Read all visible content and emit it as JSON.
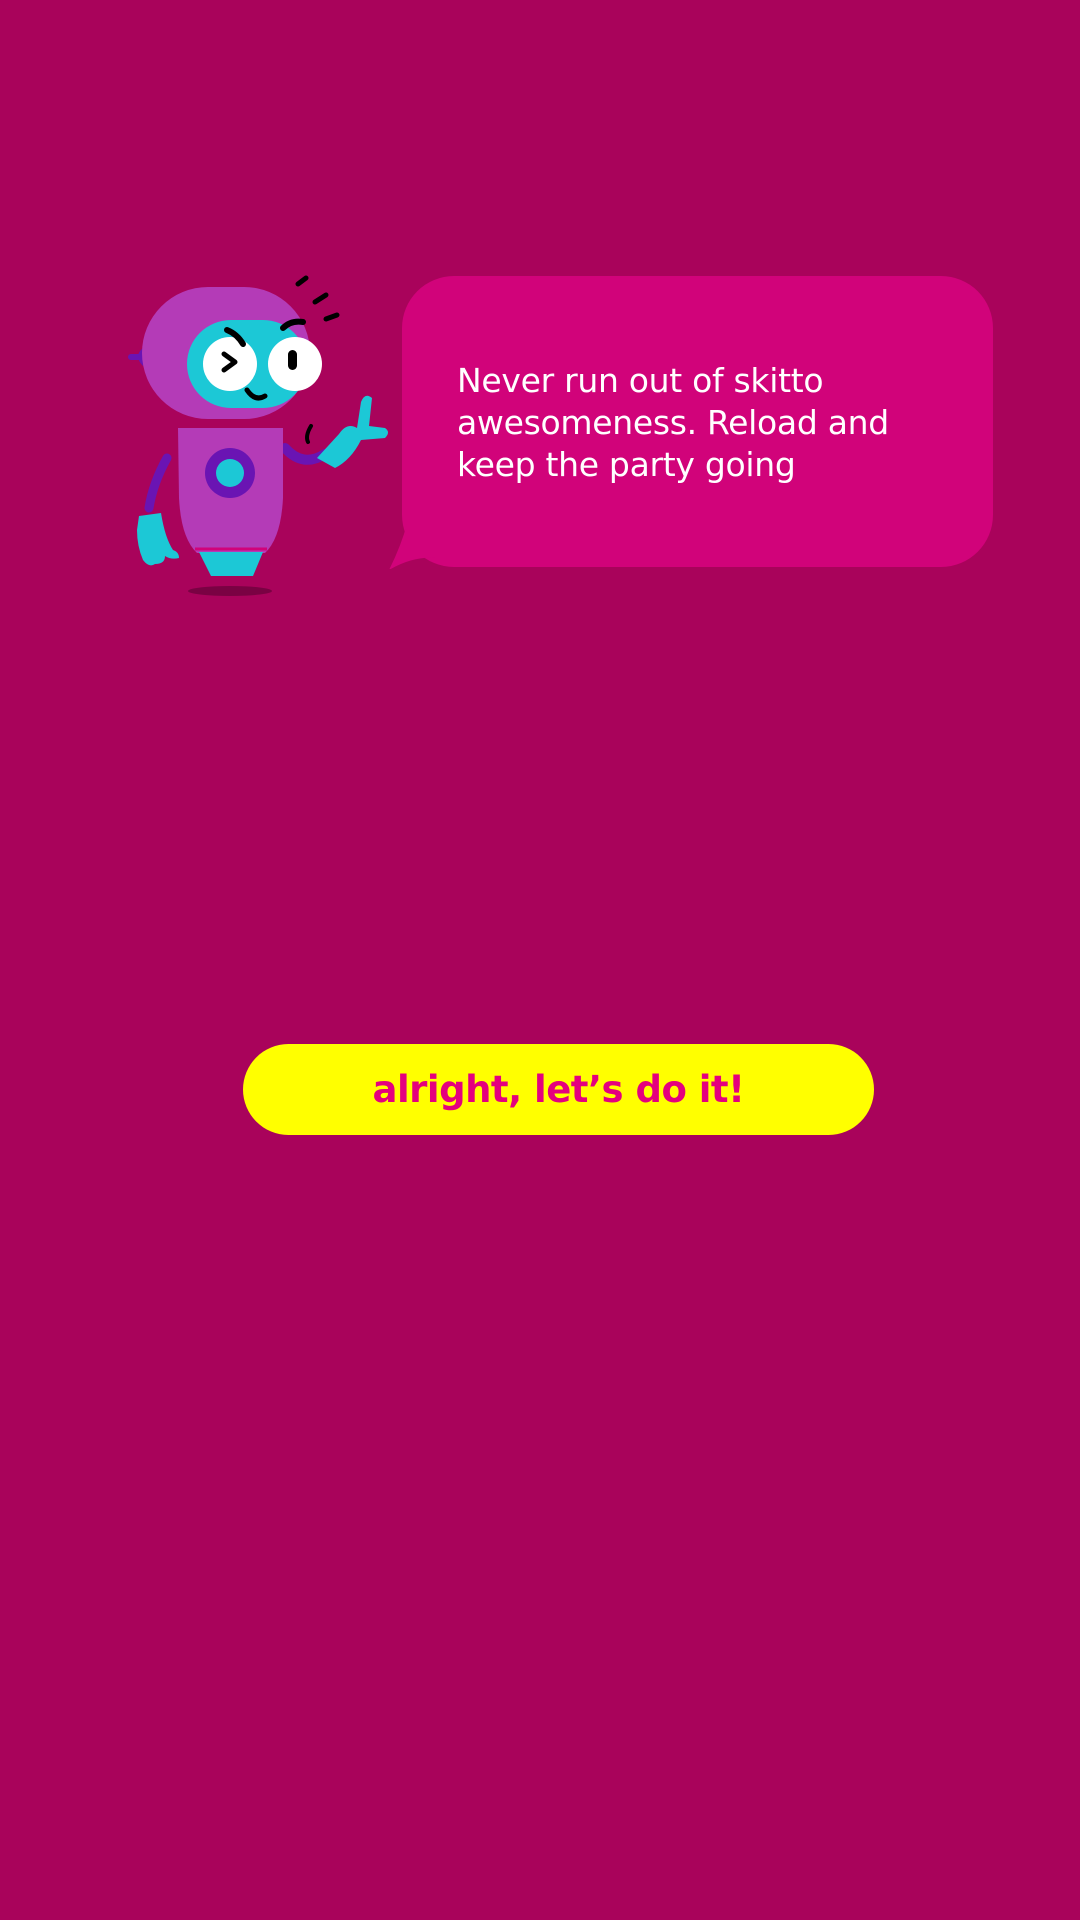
{
  "colors": {
    "background": "#A9035B",
    "bubble": "#D1037A",
    "button_bg": "#FFFF00",
    "button_text": "#E4007E",
    "mascot_body": "#B43BB7",
    "mascot_accent": "#1CC8D6",
    "mascot_dark": "#6A14B3"
  },
  "mascot": {
    "icon": "robot-mascot-icon"
  },
  "speech_bubble": {
    "message": "Never run out of skitto awesomeness. Reload and keep the party going"
  },
  "cta": {
    "label": "alright, let’s do it!"
  }
}
